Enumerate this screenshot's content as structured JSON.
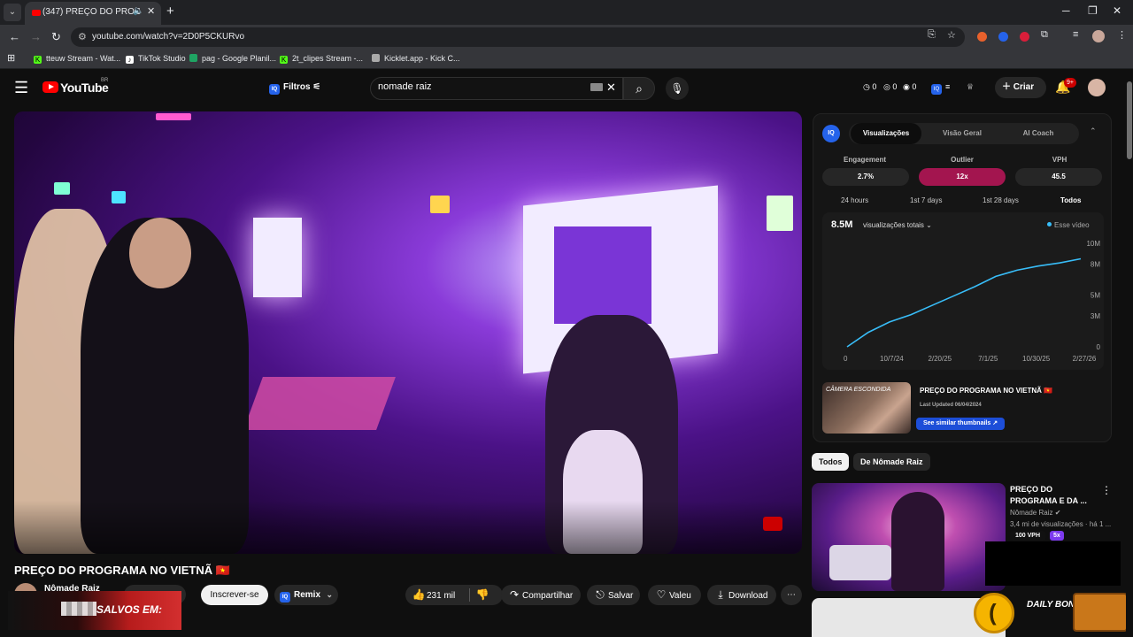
{
  "browser": {
    "tab_title": "(347) PREÇO DO PROGRAMA",
    "url": "youtube.com/watch?v=2D0P5CKURvo",
    "bookmarks": [
      "tteuw Stream - Wat...",
      "TikTok Studio",
      "pag - Google Planil...",
      "2t_clipes Stream -...",
      "Kicklet.app - Kick C..."
    ]
  },
  "masthead": {
    "logo_text": "YouTube",
    "logo_region": "BR",
    "filter_label": "Filtros",
    "search_value": "nomade raiz",
    "stats": [
      "0",
      "0",
      "0"
    ],
    "create_label": "Criar",
    "notif_count": "9+"
  },
  "video": {
    "title": "PREÇO DO PROGRAMA NO VIETNÃ 🇻🇳",
    "channel": "Nômade Raiz",
    "join_label": "o",
    "subscribe_label": "Inscrever-se",
    "remix_label": "Remix",
    "likes": "231 mil",
    "share_label": "Compartilhar",
    "save_label": "Salvar",
    "thanks_label": "Valeu",
    "download_label": "Download",
    "overlay_text": "SALVOS EM:"
  },
  "panel": {
    "logo": "IQ",
    "tabs": [
      "Visualizações",
      "Visão Geral",
      "AI Coach"
    ],
    "metrics": [
      {
        "label": "Engagement",
        "value": "2.7%"
      },
      {
        "label": "Outlier",
        "value": "12x"
      },
      {
        "label": "VPH",
        "value": "45.5"
      }
    ],
    "ranges": [
      "24 hours",
      "1st 7 days",
      "1st 28 days",
      "Todos"
    ],
    "total_views": "8.5M",
    "total_select": "visualizações totais",
    "legend": "Esse vídeo",
    "card_title": "PREÇO DO PROGRAMA NO VIETNÃ 🇻🇳",
    "card_updated": "Last Updated 06/04/2024",
    "card_thumb_text": "CÂMERA ESCONDIDA",
    "similar_label": "See similar thumbnails ↗"
  },
  "chart_data": {
    "type": "line",
    "series": [
      {
        "name": "Esse vídeo",
        "x": [
          "6/4/24",
          "7/1/24",
          "8/1/24",
          "9/1/24",
          "10/7/24",
          "11/15/24",
          "1/1/25",
          "2/20/25",
          "4/15/25",
          "7/1/25",
          "10/30/25",
          "2/27/26"
        ],
        "values": [
          0,
          1.4,
          2.4,
          3.1,
          4.0,
          4.9,
          5.8,
          6.8,
          7.4,
          7.8,
          8.1,
          8.5
        ]
      }
    ],
    "x_ticks": [
      "0",
      "10/7/24",
      "2/20/25",
      "7/1/25",
      "10/30/25",
      "2/27/26"
    ],
    "y_ticks": [
      "0",
      "3M",
      "5M",
      "8M",
      "10M"
    ],
    "ylim": [
      0,
      10
    ],
    "ylabel": "",
    "xlabel": "",
    "title": ""
  },
  "recommendations": {
    "chips": [
      "Todos",
      "De Nômade Raiz"
    ],
    "item": {
      "title": "PREÇO DO PROGRAMA E DA ...",
      "channel": "Nômade Raiz",
      "meta": "3,4 mi de visualizações · há 1 ...",
      "vph": "100 VPH",
      "multiplier": "5x"
    }
  },
  "bonus_text": "DAILY BONUS",
  "colors": {
    "accent_blue": "#2563eb",
    "outlier": "#a3154f",
    "line": "#38bdf8",
    "yt_red": "#ff0000"
  }
}
